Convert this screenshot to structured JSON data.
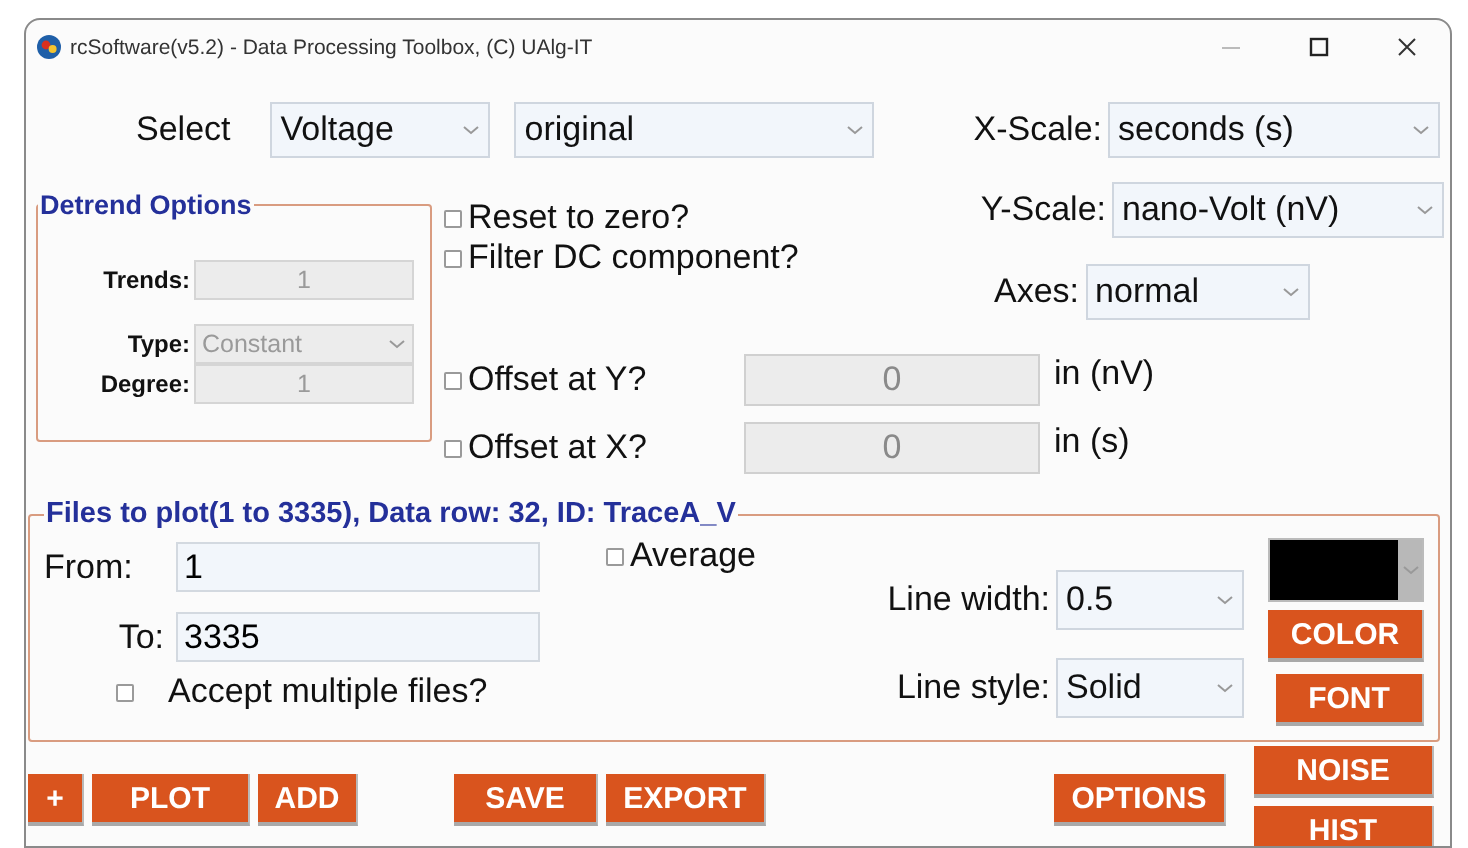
{
  "window": {
    "title": "rcSoftware(v5.2) - Data Processing Toolbox, (C) UAlg-IT"
  },
  "select": {
    "label": "Select",
    "quantity": "Voltage",
    "processing": "original"
  },
  "x_scale": {
    "label": "X-Scale:",
    "value": "seconds (s)"
  },
  "y_scale": {
    "label": "Y-Scale:",
    "value": "nano-Volt (nV)"
  },
  "axes": {
    "label": "Axes:",
    "value": "normal"
  },
  "detrend": {
    "title": "Detrend Options",
    "disabled": true,
    "fields": [
      {
        "label": "Trends:",
        "value": "1",
        "kind": "text"
      },
      {
        "label": "Type:",
        "value": "Constant",
        "kind": "dropdown"
      },
      {
        "label": "Degree:",
        "value": "1",
        "kind": "text"
      }
    ]
  },
  "options": [
    {
      "label": "Reset to zero?",
      "checked": false
    },
    {
      "label": "Filter DC component?",
      "checked": false
    }
  ],
  "offsets": [
    {
      "label": "Offset at Y?",
      "checked": false,
      "value": "0",
      "unit": "in (nV)",
      "disabled": true
    },
    {
      "label": "Offset at X?",
      "checked": false,
      "value": "0",
      "unit": "in (s)",
      "disabled": true
    }
  ],
  "files": {
    "title": "Files to plot(1 to 3335), Data row: 32, ID: TraceA_V",
    "from": {
      "label": "From:",
      "value": "1"
    },
    "to": {
      "label": "To:",
      "value": "3335"
    },
    "average": {
      "label": "Average",
      "checked": false
    },
    "multiple": {
      "label": "Accept multiple files?",
      "checked": false
    },
    "line_width": {
      "label": "Line width:",
      "value": "0.5"
    },
    "line_style": {
      "label": "Line style:",
      "value": "Solid"
    },
    "line_color": {
      "color": "#000000"
    },
    "side_buttons": [
      "COLOR",
      "FONT"
    ]
  },
  "button_groups": [
    [
      "+",
      "PLOT",
      "ADD"
    ],
    [
      "SAVE",
      "EXPORT"
    ],
    [
      "OPTIONS"
    ],
    [
      "NOISE",
      "HIST"
    ]
  ]
}
